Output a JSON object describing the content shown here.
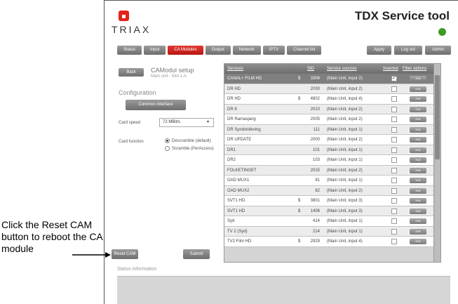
{
  "header": {
    "logo_text": "TRIAX",
    "app_title": "TDX Service tool",
    "status_color": "#3a9c1e"
  },
  "nav": {
    "tabs": [
      "Status",
      "Input",
      "CA Modules",
      "Output",
      "Network",
      "IPTV",
      "Channel list"
    ],
    "active_tab": "CA Modules",
    "buttons": [
      "Apply",
      "Log out",
      "Admin"
    ]
  },
  "left": {
    "back_label": "Back",
    "title": "CAModul setup",
    "subtitle": "Main unit - Slot 1-A",
    "config_heading": "Configuration",
    "ci_button": "Common interface",
    "card_speed_label": "Card speed",
    "card_speed_value": "72 MBit/s",
    "card_function_label": "Card function",
    "radio_descramble": "Descramble (default)",
    "radio_scramble": "Scramble (PerAccess)",
    "reset_label": "Reset CAM",
    "submit_label": "Submit"
  },
  "table": {
    "headers": {
      "services": "Services",
      "sid": "SID",
      "source": "Service sources",
      "inserted": "Inserted",
      "filter": "Filter options"
    },
    "filter_button": "Edit",
    "rows": [
      {
        "name": "CANAL+ FILM HD",
        "dollar": "$",
        "sid": "3306",
        "src": "(Main Unit, input 2)",
        "checked": true
      },
      {
        "name": "DR HD",
        "dollar": "",
        "sid": "2030",
        "src": "(Main Unit, input 2)",
        "checked": false
      },
      {
        "name": "DR HD",
        "dollar": "$",
        "sid": "4802",
        "src": "(Main Unit, input 4)",
        "checked": false
      },
      {
        "name": "DR K",
        "dollar": "",
        "sid": "2010",
        "src": "(Main Unit, input 2)",
        "checked": false
      },
      {
        "name": "DR Ramasjang",
        "dollar": "",
        "sid": "2005",
        "src": "(Main Unit, input 2)",
        "checked": false
      },
      {
        "name": "DR Syndstolkning",
        "dollar": "",
        "sid": "111",
        "src": "(Main Unit, input 1)",
        "checked": false
      },
      {
        "name": "DR UPDATE",
        "dollar": "",
        "sid": "2000",
        "src": "(Main Unit, input 2)",
        "checked": false
      },
      {
        "name": "DR1",
        "dollar": "",
        "sid": "101",
        "src": "(Main Unit, input 1)",
        "checked": false
      },
      {
        "name": "DR2",
        "dollar": "",
        "sid": "103",
        "src": "(Main Unit, input 1)",
        "checked": false
      },
      {
        "name": "FOLKETINGET",
        "dollar": "",
        "sid": "2015",
        "src": "(Main Unit, input 2)",
        "checked": false
      },
      {
        "name": "OAD MUX1",
        "dollar": "",
        "sid": "81",
        "src": "(Main Unit, input 1)",
        "checked": false
      },
      {
        "name": "OAD MUX2",
        "dollar": "",
        "sid": "82",
        "src": "(Main Unit, input 2)",
        "checked": false
      },
      {
        "name": "SVT1 HD",
        "dollar": "$",
        "sid": "3801",
        "src": "(Main Unit, input 3)",
        "checked": false
      },
      {
        "name": "SVT1 HD",
        "dollar": "$",
        "sid": "1406",
        "src": "(Main Unit, input 3)",
        "checked": false
      },
      {
        "name": "Syd",
        "dollar": "",
        "sid": "414",
        "src": "(Main Unit, input 1)",
        "checked": false
      },
      {
        "name": "TV 2 (Syd)",
        "dollar": "",
        "sid": "214",
        "src": "(Main Unit, input 1)",
        "checked": false
      },
      {
        "name": "TV2 Film HD",
        "dollar": "$",
        "sid": "2929",
        "src": "(Main Unit, input 4)",
        "checked": false
      }
    ]
  },
  "status": {
    "label": "Status information"
  },
  "annotation": {
    "text": "Click the Reset CAM button to reboot the CA module"
  }
}
